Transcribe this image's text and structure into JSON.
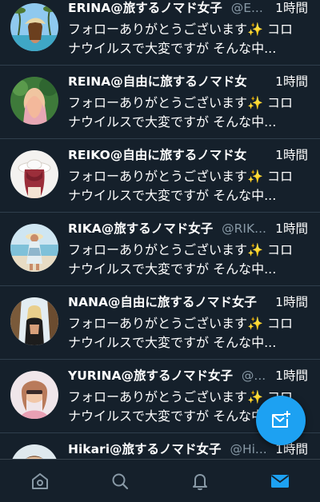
{
  "conversations": [
    {
      "name": "ERINA@旅するノマド女子",
      "handle": "@E...",
      "time": "1時間",
      "preview_line1": "フォローありがとうございます",
      "preview_emoji": "✨",
      "preview_line1_end": " コロ",
      "preview_line2": "ナウイルスで大変ですが そんな中..."
    },
    {
      "name": "REINA@自由に旅するノマド女",
      "handle": "",
      "time": "1時間",
      "preview_line1": "フォローありがとうございます",
      "preview_emoji": "✨",
      "preview_line1_end": " コロ",
      "preview_line2": "ナウイルスで大変ですが そんな中..."
    },
    {
      "name": "REIKO@自由に旅するノマド女",
      "handle": "",
      "time": "1時間",
      "preview_line1": "フォローありがとうございます",
      "preview_emoji": "✨",
      "preview_line1_end": " コロ",
      "preview_line2": "ナウイルスで大変ですが そんな中..."
    },
    {
      "name": "RIKA@旅するノマド女子",
      "handle": "@RIK...",
      "time": "1時間",
      "preview_line1": "フォローありがとうございます",
      "preview_emoji": "✨",
      "preview_line1_end": " コロ",
      "preview_line2": "ナウイルスで大変ですが そんな中..."
    },
    {
      "name": "NANA@自由に旅するノマド女子",
      "handle": "",
      "time": "1時間",
      "preview_line1": "フォローありがとうございます",
      "preview_emoji": "✨",
      "preview_line1_end": " コロ",
      "preview_line2": "ナウイルスで大変ですが そんな中..."
    },
    {
      "name": "YURINA@旅するノマド女子",
      "handle": "@...",
      "time": "1時間",
      "preview_line1": "フォローありがとうございます",
      "preview_emoji": "✨",
      "preview_line1_end": " コロ",
      "preview_line2": "ナウイルスで大変ですが そんな中..."
    },
    {
      "name": "Hikari@旅するノマド女子",
      "handle": "@Hi...",
      "time": "1時間",
      "preview_line1": "",
      "preview_emoji": "",
      "preview_line1_end": "",
      "preview_line2": ""
    }
  ],
  "compose_button": {
    "icon": "new-message-icon"
  },
  "bottom_nav": [
    {
      "icon": "home-icon",
      "active": false
    },
    {
      "icon": "search-icon",
      "active": false
    },
    {
      "icon": "bell-icon",
      "active": false
    },
    {
      "icon": "mail-icon",
      "active": true
    }
  ],
  "colors": {
    "background": "#15202b",
    "accent": "#1da1f2",
    "secondary_text": "#8899a6",
    "sparkle": "#ffcc4d",
    "divider": "#2f3e4c"
  }
}
